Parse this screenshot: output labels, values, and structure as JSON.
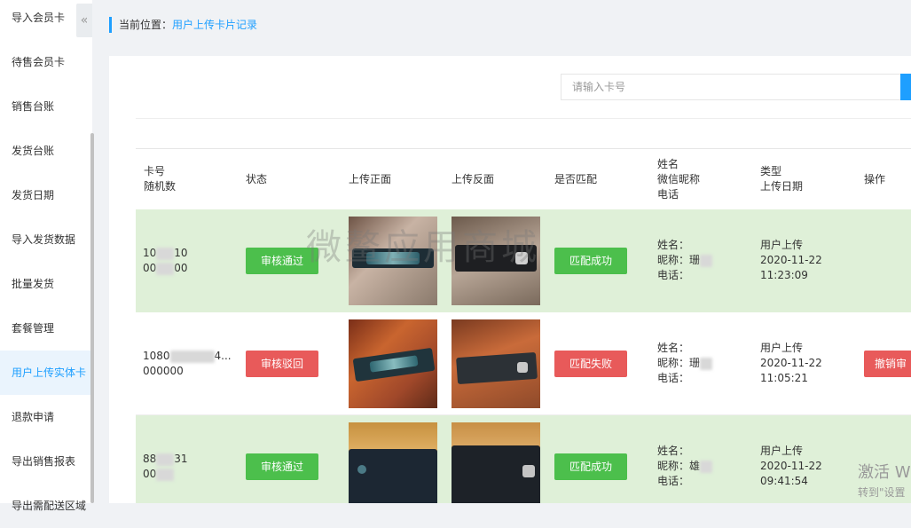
{
  "sidebar": {
    "items": [
      {
        "label": "导入会员卡"
      },
      {
        "label": "待售会员卡"
      },
      {
        "label": "销售台账"
      },
      {
        "label": "发货台账"
      },
      {
        "label": "发货日期"
      },
      {
        "label": "导入发货数据"
      },
      {
        "label": "批量发货"
      },
      {
        "label": "套餐管理"
      },
      {
        "label": "用户上传实体卡"
      },
      {
        "label": "退款申请"
      },
      {
        "label": "导出销售报表"
      },
      {
        "label": "导出需配送区域"
      }
    ],
    "collapse_glyph": "«"
  },
  "breadcrumb": {
    "label": "当前位置：",
    "current": "用户上传卡片记录"
  },
  "search": {
    "placeholder": "请输入卡号"
  },
  "table": {
    "headers": {
      "card": [
        "卡号",
        "随机数"
      ],
      "status": "状态",
      "front": "上传正面",
      "back": "上传反面",
      "match": "是否匹配",
      "user": [
        "姓名",
        "微信昵称",
        "电话"
      ],
      "type": [
        "类型",
        "上传日期"
      ],
      "action": "操作"
    },
    "rows": [
      {
        "card_line1": "10",
        "card_line1_tail": "10",
        "card_line2": "00",
        "card_line2_tail": "00",
        "status": "审核通过",
        "status_kind": "ok",
        "match": "匹配成功",
        "match_kind": "ok",
        "name_label": "姓名：",
        "nick_label": "昵称：",
        "nick_value": "珊",
        "phone_label": "电话：",
        "type": "用户上传",
        "date": "2020-11-22",
        "time": "11:23:09",
        "action": ""
      },
      {
        "card_line1": "1080",
        "card_line1_tail": "4...",
        "card_line2": "000000",
        "card_line2_tail": "",
        "status": "审核驳回",
        "status_kind": "bad",
        "match": "匹配失败",
        "match_kind": "bad",
        "name_label": "姓名：",
        "nick_label": "昵称：",
        "nick_value": "珊",
        "phone_label": "电话：",
        "type": "用户上传",
        "date": "2020-11-22",
        "time": "11:05:21",
        "action": "撤销审"
      },
      {
        "card_line1": "88",
        "card_line1_tail": "31",
        "card_line2": "00",
        "card_line2_tail": "",
        "status": "审核通过",
        "status_kind": "ok",
        "match": "匹配成功",
        "match_kind": "ok",
        "name_label": "姓名：",
        "nick_label": "昵称：",
        "nick_value": "雄",
        "phone_label": "电话：",
        "type": "用户上传",
        "date": "2020-11-22",
        "time": "09:41:54",
        "action": ""
      }
    ]
  },
  "watermark": "微鳌应用商城",
  "os_overlay": {
    "line1": "激活 W",
    "line2": "转到\"设置"
  }
}
